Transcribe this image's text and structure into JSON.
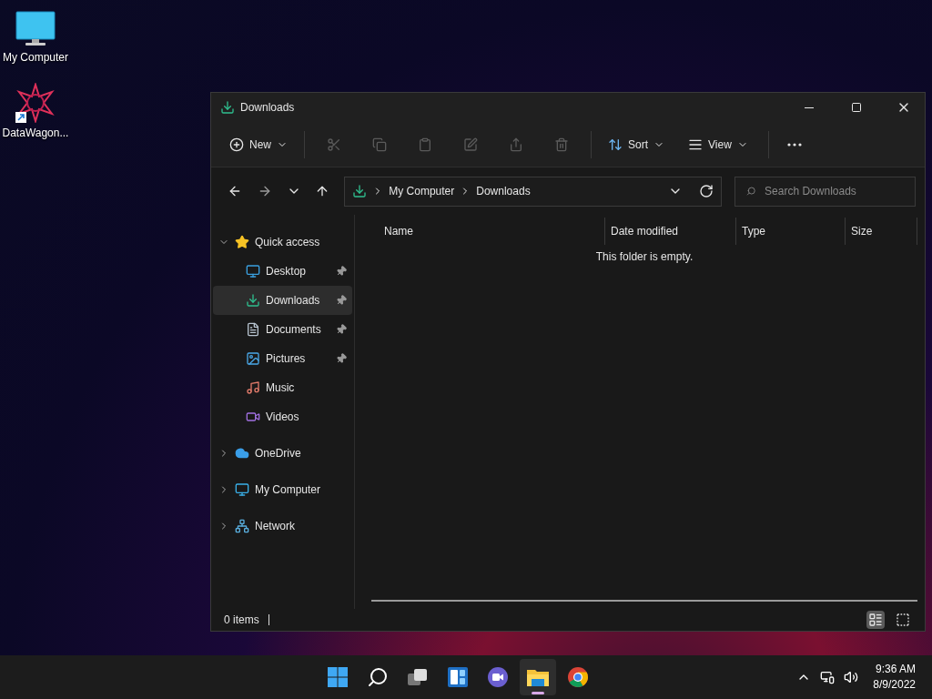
{
  "desktop_icons": [
    {
      "label": "My Computer",
      "kind": "computer",
      "shortcut": false
    },
    {
      "label": "DataWagon...",
      "kind": "app",
      "shortcut": true
    }
  ],
  "window": {
    "title": "Downloads",
    "toolbar": {
      "new_label": "New",
      "actions": [
        {
          "kind": "cut",
          "disabled": true
        },
        {
          "kind": "copy",
          "disabled": true
        },
        {
          "kind": "paste",
          "disabled": true
        },
        {
          "kind": "rename",
          "disabled": true
        },
        {
          "kind": "share",
          "disabled": true
        },
        {
          "kind": "delete",
          "disabled": true
        }
      ],
      "sort_label": "Sort",
      "view_label": "View"
    },
    "address": {
      "path": [
        "My Computer",
        "Downloads"
      ],
      "search_placeholder": "Search Downloads"
    },
    "sidebar": [
      {
        "label": "Quick access",
        "kind": "star",
        "expanded": true,
        "children": [
          {
            "label": "Desktop",
            "kind": "desktop",
            "pinned": true,
            "selected": false
          },
          {
            "label": "Downloads",
            "kind": "download",
            "pinned": true,
            "selected": true
          },
          {
            "label": "Documents",
            "kind": "documents",
            "pinned": true,
            "selected": false
          },
          {
            "label": "Pictures",
            "kind": "pictures",
            "pinned": true,
            "selected": false
          },
          {
            "label": "Music",
            "kind": "music",
            "pinned": false,
            "selected": false
          },
          {
            "label": "Videos",
            "kind": "videos",
            "pinned": false,
            "selected": false
          }
        ]
      },
      {
        "label": "OneDrive",
        "kind": "cloud",
        "expanded": false
      },
      {
        "label": "My Computer",
        "kind": "computer",
        "expanded": false
      },
      {
        "label": "Network",
        "kind": "network",
        "expanded": false
      }
    ],
    "columns": [
      "Name",
      "Date modified",
      "Type",
      "Size"
    ],
    "empty_message": "This folder is empty.",
    "status": "0 items",
    "view_buttons": [
      {
        "kind": "details",
        "selected": true
      },
      {
        "kind": "tiles",
        "selected": false
      }
    ]
  },
  "taskbar": {
    "apps": [
      {
        "kind": "start",
        "active": false
      },
      {
        "kind": "search",
        "active": false
      },
      {
        "kind": "taskview",
        "active": false
      },
      {
        "kind": "widgets",
        "active": false
      },
      {
        "kind": "chat",
        "active": false
      },
      {
        "kind": "explorer",
        "active": true
      },
      {
        "kind": "browser",
        "active": false
      }
    ],
    "time": "9:36 AM",
    "date": "8/9/2022"
  }
}
